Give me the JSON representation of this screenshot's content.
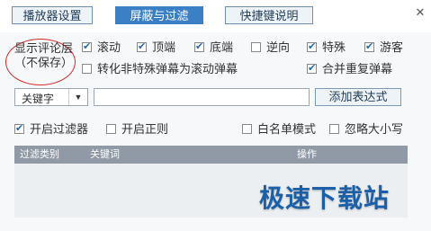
{
  "tabs": [
    {
      "label": "播放器设置",
      "active": false
    },
    {
      "label": "屏蔽与过滤",
      "active": true
    },
    {
      "label": "快捷键说明",
      "active": false
    }
  ],
  "close_glyph": "✕",
  "comment_layer": {
    "line1": "显示评论层",
    "line2": "（不保存）"
  },
  "checkbox_labels": {
    "scroll": "滚动",
    "top": "顶端",
    "bottom": "底端",
    "reverse": "逆向",
    "special": "特殊",
    "guest": "游客",
    "convert": "转化非特殊弹幕为滚动弹幕",
    "merge": "合并重复弹幕",
    "enable_filter": "开启过滤器",
    "enable_regex": "开启正则",
    "whitelist": "白名单模式",
    "ignore_case": "忽略大小写"
  },
  "checked": {
    "scroll": true,
    "top": true,
    "bottom": true,
    "reverse": false,
    "special": true,
    "guest": true,
    "convert": false,
    "merge": true,
    "enable_filter": true,
    "enable_regex": false,
    "whitelist": false,
    "ignore_case": false
  },
  "select": {
    "value": "关键字"
  },
  "add_button": "添加表达式",
  "table": {
    "headers": [
      "过滤类别",
      "关键词",
      "操作"
    ]
  },
  "watermark": "极速下载站",
  "colors": {
    "accent": "#3b7fc4",
    "annotation": "#d42b2b",
    "watermark": "#1b5fa8"
  }
}
